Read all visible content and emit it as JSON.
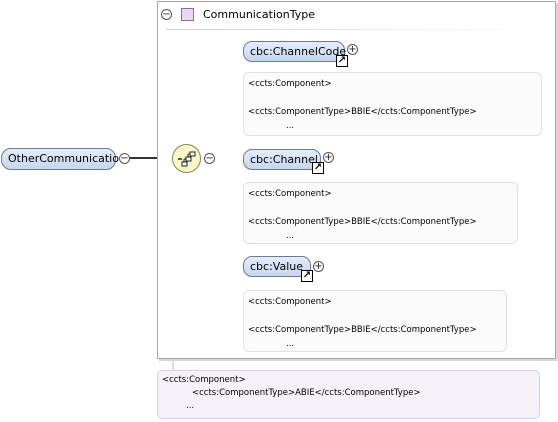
{
  "root_element": {
    "name": "OtherCommunication"
  },
  "complex_type": {
    "name": "CommunicationType",
    "documentation": [
      "<ccts:Component>",
      "<ccts:ComponentType>ABIE</ccts:ComponentType>",
      "..."
    ]
  },
  "sequence": {
    "icon": "sequence-compositor-icon"
  },
  "children": [
    {
      "name": "cbc:ChannelCode",
      "documentation": [
        "<ccts:Component>",
        "<ccts:ComponentType>BBIE</ccts:ComponentType>",
        "..."
      ]
    },
    {
      "name": "cbc:Channel",
      "documentation": [
        "<ccts:Component>",
        "<ccts:ComponentType>BBIE</ccts:ComponentType>",
        "..."
      ]
    },
    {
      "name": "cbc:Value",
      "documentation": [
        "<ccts:Component>",
        "<ccts:ComponentType>BBIE</ccts:ComponentType>",
        "..."
      ]
    }
  ],
  "toggles": {
    "collapse": "−",
    "expand": "+"
  },
  "icons": {
    "reference": "reference-arrow-icon",
    "type": "complex-type-icon",
    "collapse": "collapse-icon",
    "expand": "expand-icon"
  },
  "colors": {
    "node_fill": "#c7d6ee",
    "sequence_fill": "#fbf6c8",
    "type_icon": "#e8d8f0"
  }
}
